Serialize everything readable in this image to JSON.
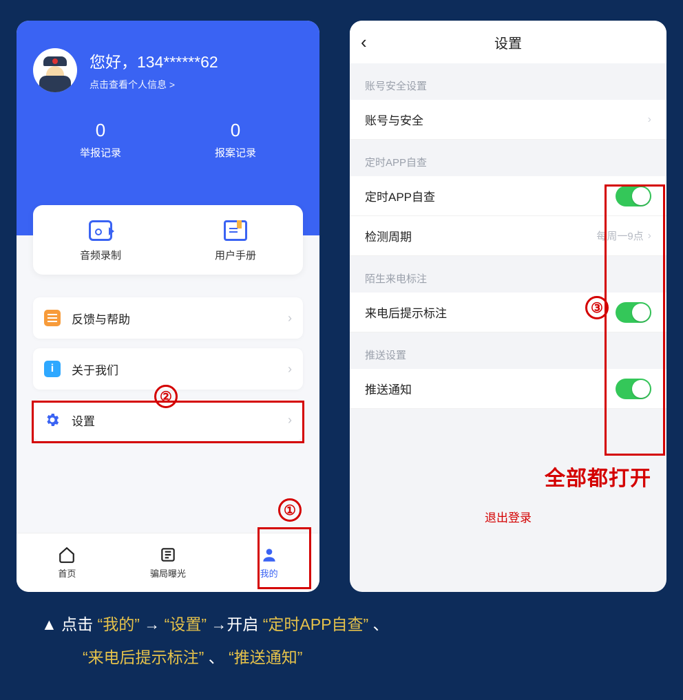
{
  "left": {
    "greeting": "您好，134******62",
    "profile_hint": "点击查看个人信息 >",
    "stats": [
      {
        "value": "0",
        "label": "举报记录"
      },
      {
        "value": "0",
        "label": "报案记录"
      }
    ],
    "tools": [
      {
        "id": "audio",
        "label": "音频录制"
      },
      {
        "id": "manual",
        "label": "用户手册"
      }
    ],
    "menu": [
      {
        "id": "feedback",
        "label": "反馈与帮助"
      },
      {
        "id": "about",
        "label": "关于我们"
      },
      {
        "id": "settings",
        "label": "设置"
      }
    ],
    "tabs": [
      {
        "id": "home",
        "label": "首页"
      },
      {
        "id": "expose",
        "label": "骗局曝光"
      },
      {
        "id": "mine",
        "label": "我的"
      }
    ]
  },
  "right": {
    "title": "设置",
    "sections": {
      "account_sec_title": "账号安全设置",
      "account_row": "账号与安全",
      "timer_sec_title": "定时APP自查",
      "timer_row": "定时APP自查",
      "cycle_row": "检测周期",
      "cycle_value": "每周一9点",
      "caller_sec_title": "陌生来电标注",
      "caller_row": "来电后提示标注",
      "push_sec_title": "推送设置",
      "push_row": "推送通知"
    },
    "logout": "退出登录",
    "note": "全部都打开"
  },
  "annot": {
    "n1": "①",
    "n2": "②",
    "n3": "③"
  },
  "caption": {
    "prefix": "▲ 点击",
    "q1": "“我的”",
    "arrow": "→",
    "q2": "“设置”",
    "mid": "→开启",
    "q3": "“定时APP自查”",
    "sep": "、",
    "q4": "“来电后提示标注”",
    "q5": "“推送通知”"
  }
}
